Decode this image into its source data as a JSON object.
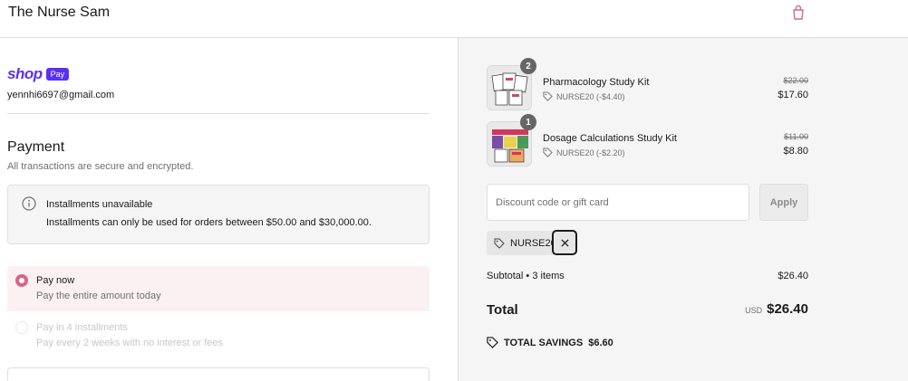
{
  "header": {
    "store_name": "The Nurse Sam",
    "cart_icon": "shopping-bag-icon"
  },
  "shop_pay": {
    "shop": "shop",
    "pay": "Pay"
  },
  "account": {
    "email": "yennhi6697@gmail.com"
  },
  "payment": {
    "title": "Payment",
    "subtitle": "All transactions are secure and encrypted.",
    "notice": {
      "icon": "info-icon",
      "title": "Installments unavailable",
      "body": "Installments can only be used for orders between $50.00 and $30,000.00."
    },
    "options": [
      {
        "label": "Pay now",
        "sub": "Pay the entire amount today",
        "selected": true
      },
      {
        "label": "Pay in 4 installments",
        "sub": "Pay every 2 weeks with no interest or fees",
        "selected": false
      }
    ]
  },
  "order": {
    "items": [
      {
        "name": "Pharmacology Study Kit",
        "qty": "2",
        "discount": "NURSE20 (-$4.40)",
        "price_old": "$22.00",
        "price_new": "$17.60"
      },
      {
        "name": "Dosage Calculations Study Kit",
        "qty": "1",
        "discount": "NURSE20 (-$2.20)",
        "price_old": "$11.00",
        "price_new": "$8.80"
      }
    ],
    "discount_placeholder": "Discount code or gift card",
    "apply_label": "Apply",
    "applied_code": "NURSE20",
    "subtotal_label": "Subtotal • 3 items",
    "subtotal_value": "$26.40",
    "total_label": "Total",
    "currency": "USD",
    "total_value": "$26.40",
    "savings_label": "TOTAL SAVINGS",
    "savings_value": "$6.60"
  },
  "colors": {
    "accent": "#d4678a",
    "shop_pay": "#5a31f4",
    "summary_bg": "#f5f5f5"
  }
}
